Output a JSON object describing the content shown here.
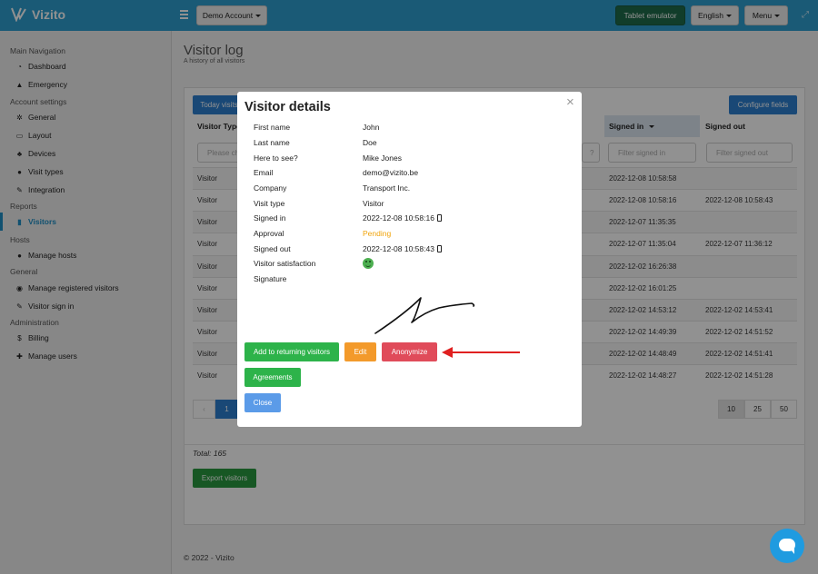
{
  "app": {
    "brand": "Vizito"
  },
  "topbar": {
    "account_label": "Demo Account",
    "tablet_label": "Tablet emulator",
    "language_label": "English",
    "menu_label": "Menu"
  },
  "sidebar": {
    "sections": [
      {
        "title": "Main Navigation",
        "items": [
          {
            "label": "Dashboard",
            "icon": "dashboard-icon"
          },
          {
            "label": "Emergency",
            "icon": "warning-icon"
          }
        ]
      },
      {
        "title": "Account settings",
        "items": [
          {
            "label": "General",
            "icon": "gear-icon"
          },
          {
            "label": "Layout",
            "icon": "layout-icon"
          },
          {
            "label": "Devices",
            "icon": "devices-icon"
          },
          {
            "label": "Visit types",
            "icon": "users-icon"
          },
          {
            "label": "Integration",
            "icon": "plug-icon"
          }
        ]
      },
      {
        "title": "Reports",
        "items": [
          {
            "label": "Visitors",
            "icon": "chart-icon"
          }
        ]
      },
      {
        "title": "Hosts",
        "items": [
          {
            "label": "Manage hosts",
            "icon": "users-icon"
          }
        ]
      },
      {
        "title": "General",
        "items": [
          {
            "label": "Manage registered visitors",
            "icon": "user-icon"
          },
          {
            "label": "Visitor sign in",
            "icon": "pencil-icon"
          }
        ]
      },
      {
        "title": "Administration",
        "items": [
          {
            "label": "Billing",
            "icon": "dollar-icon"
          },
          {
            "label": "Manage users",
            "icon": "user-plus-icon"
          }
        ]
      }
    ]
  },
  "page": {
    "title": "Visitor log",
    "subtitle": "A history of all visitors"
  },
  "toolbar": {
    "today_label": "Today visits",
    "configure_label": "Configure fields"
  },
  "table": {
    "columns": {
      "visitor_type": "Visitor Type",
      "signed_in": "Signed in",
      "signed_out": "Signed out"
    },
    "filters": {
      "type_placeholder": "Please ch",
      "middle_placeholder": "?",
      "signed_in_placeholder": "Filter signed in",
      "signed_out_placeholder": "Filter signed out"
    },
    "rows": [
      {
        "type": "Visitor",
        "signed_in": "2022-12-08 10:58:58",
        "signed_out": ""
      },
      {
        "type": "Visitor",
        "signed_in": "2022-12-08 10:58:16",
        "signed_out": "2022-12-08 10:58:43"
      },
      {
        "type": "Visitor",
        "signed_in": "2022-12-07 11:35:35",
        "signed_out": ""
      },
      {
        "type": "Visitor",
        "signed_in": "2022-12-07 11:35:04",
        "signed_out": "2022-12-07 11:36:12"
      },
      {
        "type": "Visitor",
        "signed_in": "2022-12-02 16:26:38",
        "signed_out": ""
      },
      {
        "type": "Visitor",
        "signed_in": "2022-12-02 16:01:25",
        "signed_out": ""
      },
      {
        "type": "Visitor",
        "signed_in": "2022-12-02 14:53:12",
        "signed_out": "2022-12-02 14:53:41"
      },
      {
        "type": "Visitor",
        "signed_in": "2022-12-02 14:49:39",
        "signed_out": "2022-12-02 14:51:52"
      },
      {
        "type": "Visitor",
        "signed_in": "2022-12-02 14:48:49",
        "signed_out": "2022-12-02 14:51:41"
      },
      {
        "type": "Visitor",
        "signed_in": "2022-12-02 14:48:27",
        "signed_out": "2022-12-02 14:51:28"
      }
    ]
  },
  "pagination": {
    "current": "1",
    "sizes": [
      "10",
      "25",
      "50"
    ],
    "selected_size": "10"
  },
  "total_label": "Total: 165",
  "export_label": "Export visitors",
  "footer": "© 2022 - Vizito",
  "modal": {
    "title": "Visitor details",
    "close_symbol": "×",
    "fields": [
      {
        "label": "First name",
        "value": "John"
      },
      {
        "label": "Last name",
        "value": "Doe"
      },
      {
        "label": "Here to see?",
        "value": "Mike Jones"
      },
      {
        "label": "Email",
        "value": "demo@vizito.be"
      },
      {
        "label": "Company",
        "value": "Transport Inc."
      },
      {
        "label": "Visit type",
        "value": "Visitor"
      },
      {
        "label": "Signed in",
        "value": "2022-12-08 10:58:16"
      },
      {
        "label": "Approval",
        "value": "Pending"
      },
      {
        "label": "Signed out",
        "value": "2022-12-08 10:58:43"
      },
      {
        "label": "Visitor satisfaction",
        "value": ""
      },
      {
        "label": "Signature",
        "value": ""
      }
    ],
    "buttons": {
      "returning": "Add to returning visitors",
      "edit": "Edit",
      "anonymize": "Anonymize",
      "agreements": "Agreements",
      "close": "Close"
    }
  },
  "colors": {
    "topbar": "#2f9fd0",
    "accent": "#1f8fc5",
    "pending": "#f0a30a",
    "green": "#2db34a",
    "orange": "#f39a2b",
    "red": "#e04b5a",
    "arrow": "#e02020"
  }
}
